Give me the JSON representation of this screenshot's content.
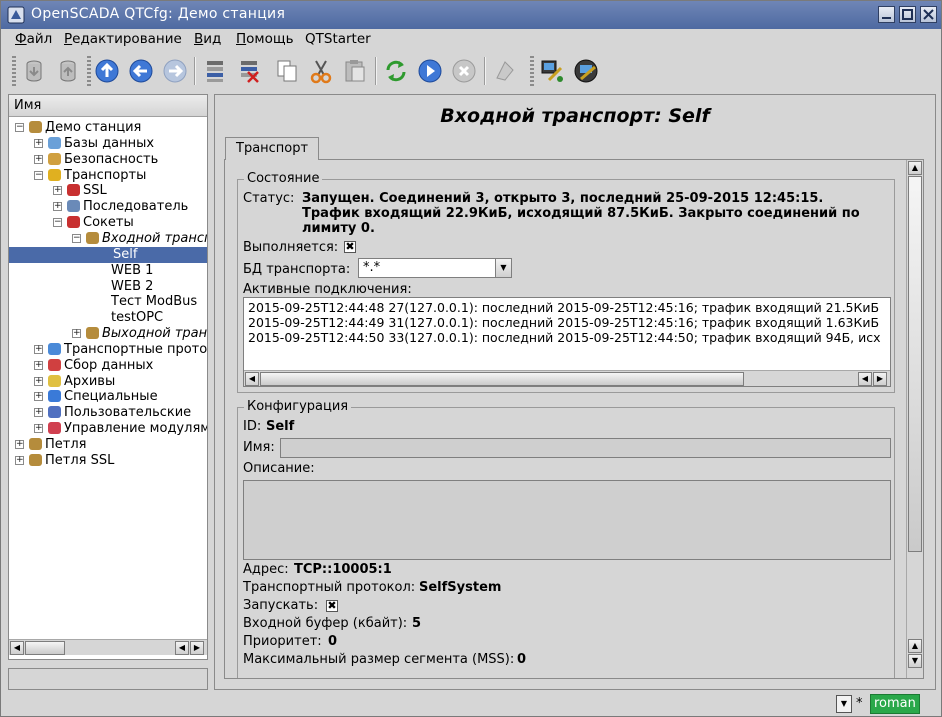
{
  "window": {
    "title": "OpenSCADA QTCfg: Демо станция",
    "buttons": [
      "minimize-icon",
      "maximize-icon",
      "close-icon"
    ]
  },
  "menu": {
    "items": [
      {
        "label": "Файл",
        "mnemonic": "Ф",
        "rest": "айл"
      },
      {
        "label": "Редактирование",
        "mnemonic": "Р",
        "rest": "едактирование"
      },
      {
        "label": "Вид",
        "mnemonic": "В",
        "rest": "ид"
      },
      {
        "label": "Помощь",
        "mnemonic": "П",
        "rest": "омощь"
      },
      {
        "label": "QTStarter",
        "mnemonic": "",
        "rest": "QTStarter"
      }
    ]
  },
  "toolbar": {
    "icons": [
      "db-load-icon",
      "db-save-icon",
      "up-icon",
      "back-icon",
      "forward-icon",
      "add-item-icon",
      "delete-item-icon",
      "copy-icon",
      "cut-icon",
      "paste-icon",
      "refresh-icon",
      "start-icon",
      "stop-icon",
      "whats-this-icon",
      "tool-config-icon",
      "tool-edit-icon"
    ]
  },
  "tree": {
    "header": "Имя",
    "nodes": [
      {
        "label": "Демо станция",
        "level": 0,
        "italic": false,
        "selected": false,
        "expanded": true
      },
      {
        "label": "Базы данных",
        "level": 1,
        "italic": false,
        "selected": false,
        "expanded": false
      },
      {
        "label": "Безопасность",
        "level": 1,
        "italic": false,
        "selected": false,
        "expanded": false
      },
      {
        "label": "Транспорты",
        "level": 1,
        "italic": false,
        "selected": false,
        "expanded": true
      },
      {
        "label": "SSL",
        "level": 2,
        "italic": false,
        "selected": false,
        "expanded": false
      },
      {
        "label": "Последователь",
        "level": 2,
        "italic": false,
        "selected": false,
        "expanded": false
      },
      {
        "label": "Сокеты",
        "level": 2,
        "italic": false,
        "selected": false,
        "expanded": true
      },
      {
        "label": "Входной транспо",
        "level": 3,
        "italic": true,
        "selected": false,
        "expanded": true
      },
      {
        "label": "Self",
        "level": 4,
        "italic": false,
        "selected": true,
        "expanded": false
      },
      {
        "label": "WEB 1",
        "level": 4,
        "italic": false,
        "selected": false,
        "expanded": false
      },
      {
        "label": "WEB 2",
        "level": 4,
        "italic": false,
        "selected": false,
        "expanded": false
      },
      {
        "label": "Тест ModBus",
        "level": 4,
        "italic": false,
        "selected": false,
        "expanded": false
      },
      {
        "label": "testOPC",
        "level": 4,
        "italic": false,
        "selected": false,
        "expanded": false
      },
      {
        "label": "Выходной трансп",
        "level": 3,
        "italic": true,
        "selected": false,
        "expanded": false
      },
      {
        "label": "Транспортные прото",
        "level": 1,
        "italic": false,
        "selected": false,
        "expanded": false
      },
      {
        "label": "Сбор данных",
        "level": 1,
        "italic": false,
        "selected": false,
        "expanded": false
      },
      {
        "label": "Архивы",
        "level": 1,
        "italic": false,
        "selected": false,
        "expanded": false
      },
      {
        "label": "Специальные",
        "level": 1,
        "italic": false,
        "selected": false,
        "expanded": false
      },
      {
        "label": "Пользовательские",
        "level": 1,
        "italic": false,
        "selected": false,
        "expanded": false
      },
      {
        "label": "Управление модулям",
        "level": 1,
        "italic": false,
        "selected": false,
        "expanded": false
      },
      {
        "label": "Петля",
        "level": 0,
        "italic": false,
        "selected": false,
        "expanded": false
      },
      {
        "label": "Петля SSL",
        "level": 0,
        "italic": false,
        "selected": false,
        "expanded": false
      }
    ]
  },
  "page": {
    "title": "Входной транспорт: Self",
    "tab": "Транспорт"
  },
  "state": {
    "group_title": "Состояние",
    "status_label": "Статус:",
    "status_line1": "Запущен. Соединений 3, открыто 3, последний 25-09-2015 12:45:15.",
    "status_line2": "Трафик входящий 22.9КиБ, исходящий 87.5КиБ. Закрыто соединений по",
    "status_line3": "лимиту 0.",
    "running_label": "Выполняется:",
    "running_checked": true,
    "db_label": "БД транспорта:",
    "db_value": "*.*",
    "active_conn_label": "Активные подключения:",
    "connections": [
      "2015-09-25T12:44:48 27(127.0.0.1): последний 2015-09-25T12:45:16; трафик входящий 21.5КиБ",
      "2015-09-25T12:44:49 31(127.0.0.1): последний 2015-09-25T12:45:16; трафик входящий 1.63КиБ",
      "2015-09-25T12:44:50 33(127.0.0.1): последний 2015-09-25T12:44:50; трафик входящий 94Б, исх"
    ]
  },
  "config": {
    "group_title": "Конфигурация",
    "id_label": "ID:",
    "id_value": "Self",
    "name_label": "Имя:",
    "name_value": "",
    "descr_label": "Описание:",
    "descr_value": "",
    "addr_label": "Адрес:",
    "addr_value": "TCP::10005:1",
    "proto_label": "Транспортный протокол:",
    "proto_value": "SelfSystem",
    "start_label": "Запускать:",
    "start_checked": true,
    "inbuf_label": "Входной буфер (кбайт):",
    "inbuf_value": "5",
    "prio_label": "Приоритет:",
    "prio_value": "0",
    "mss_label": "Максимальный размер сегмента (MSS):",
    "mss_value": "0"
  },
  "statusbar": {
    "user": "roman",
    "modified_mark": "*"
  },
  "colors": {
    "selection": "#4a6aa8",
    "titlebar": "#5873a8",
    "user_badge": "#2aa84a"
  }
}
